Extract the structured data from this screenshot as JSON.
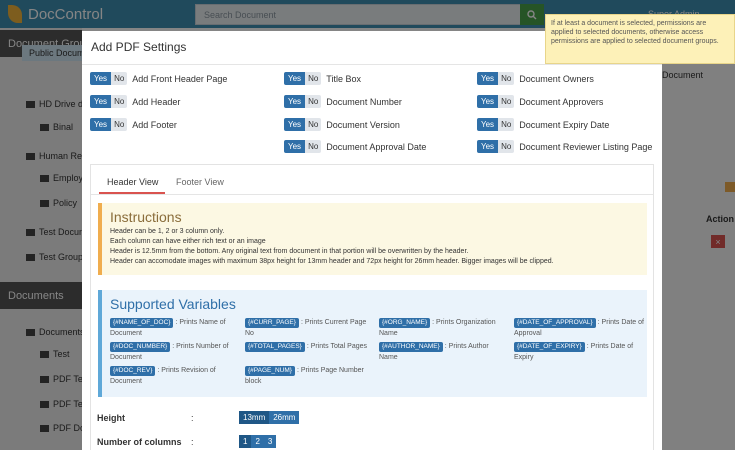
{
  "app": {
    "title": "DocControl",
    "search_placeholder": "Search Document",
    "user_name": "Super Admin"
  },
  "sidebar": {
    "groups_header": "Document Groups",
    "group_items": [
      "Public Documents",
      "HD Drive documents",
      "Binal",
      "Human Resources",
      "Employee",
      "Policy",
      "Test Document",
      "Test Group"
    ],
    "documents_header": "Documents",
    "document_items": [
      "Documents",
      "Test",
      "PDF Test",
      "PDF Test",
      "PDF Document"
    ]
  },
  "right_panel": {
    "label_document": "Document",
    "label_action": "Action",
    "delete_label": "×"
  },
  "modal": {
    "title": "Add PDF Settings",
    "toggle_yes": "Yes",
    "toggle_no": "No",
    "options": [
      "Add Front Header Page",
      "Title Box",
      "Document Owners",
      "Add Header",
      "Document Number",
      "Document Approvers",
      "Add Footer",
      "Document Version",
      "Document Expiry Date",
      "Document Approval Date",
      "Document Reviewer Listing Page"
    ],
    "tabs": [
      "Header View",
      "Footer View"
    ],
    "instructions": {
      "title": "Instructions",
      "lines": [
        "Header can be 1, 2 or 3 column only.",
        "Each column can have either rich text or an image",
        "Header is 12.5mm from the bottom. Any original text from document in that portion will be overwritten by the header.",
        "Header can accomodate images with maximum 38px height for 13mm header and 72px height for 26mm header. Bigger images will be clipped."
      ]
    },
    "variables": {
      "title": "Supported Variables",
      "items": [
        {
          "tag": "{#NAME_OF_DOC}",
          "desc": ": Prints Name of Document"
        },
        {
          "tag": "{#CURR_PAGE}",
          "desc": ": Prints Current Page No"
        },
        {
          "tag": "{#ORG_NAME}",
          "desc": ": Prints Organization Name"
        },
        {
          "tag": "{#DATE_OF_APPROVAL}",
          "desc": ": Prints Date of Approval"
        },
        {
          "tag": "{#DOC_NUMBER}",
          "desc": ": Prints Number of Document"
        },
        {
          "tag": "{#TOTAL_PAGES}",
          "desc": ": Prints Total Pages"
        },
        {
          "tag": "{#AUTHOR_NAME}",
          "desc": ": Prints Author Name"
        },
        {
          "tag": "{#DATE_OF_EXPIRY}",
          "desc": ": Prints Date of Expiry"
        },
        {
          "tag": "{#DOC_REV}",
          "desc": ": Prints Revision of Document"
        },
        {
          "tag": "{#PAGE_NUM}",
          "desc": ": Prints Page Number block"
        }
      ]
    },
    "height": {
      "label": "Height",
      "colon": ":",
      "options": [
        "13mm",
        "26mm"
      ]
    },
    "columns": {
      "label": "Number of columns",
      "colon": ":",
      "options": [
        "1",
        "2",
        "3"
      ]
    }
  },
  "tooltip": "If at least a document is selected, permissions are applied to selected documents, otherwise access permissions are applied to selected document groups.",
  "colors": {
    "topbar": "#3f8fb0",
    "primary": "#2f6fa8",
    "danger": "#d9534f",
    "warning": "#f0ad4e",
    "success": "#4aa24a"
  }
}
